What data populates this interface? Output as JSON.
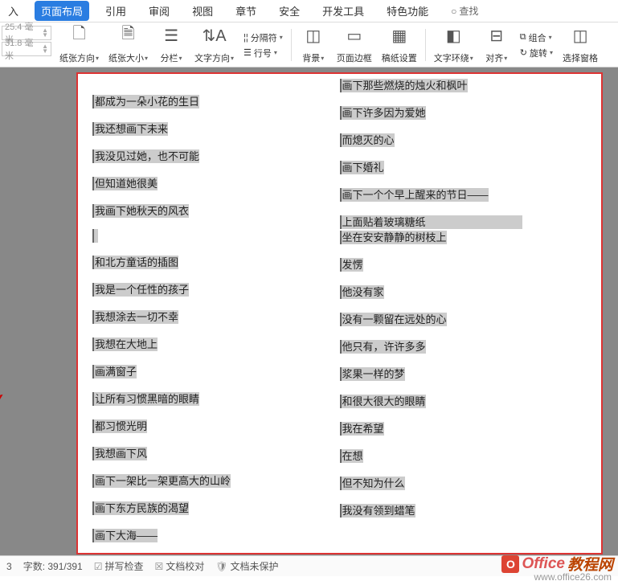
{
  "tabs": {
    "insert": "入",
    "pagelayout": "页面布局",
    "reference": "引用",
    "review": "审阅",
    "view": "视图",
    "chapter": "章节",
    "security": "安全",
    "devtools": "开发工具",
    "special": "特色功能",
    "search": "查找"
  },
  "margins": {
    "left": "25.4 毫米",
    "right": "31.8 毫米"
  },
  "toolbar": {
    "orientation": "纸张方向",
    "size": "纸张大小",
    "columns": "分栏",
    "textdir": "文字方向",
    "separator": "分隔符",
    "linenum": "行号",
    "background": "背景",
    "pageborder": "页面边框",
    "papersettings": "稿纸设置",
    "textwrap": "文字环绕",
    "align": "对齐",
    "group": "组合",
    "rotate": "旋转",
    "selpane": "选择窗格"
  },
  "content": {
    "left": [
      "都成为一朵小花的生日",
      "我还想画下未来",
      "我没见过她，也不可能",
      "但知道她很美",
      "我画下她秋天的风衣",
      "",
      "和北方童话的插图",
      "我是一个任性的孩子",
      "我想涂去一切不幸",
      "我想在大地上",
      "画满窗子",
      "让所有习惯黑暗的眼睛",
      "都习惯光明",
      "我想画下风",
      "画下一架比一架更高大的山岭",
      "画下东方民族的渴望",
      "画下大海——"
    ],
    "right": [
      "画下那些燃烧的烛火和枫叶",
      "画下许多因为爱她",
      "而熄灭的心",
      "画下婚礼",
      "画下一个个早上醒来的节日——",
      "上面贴着玻璃糖纸",
      "坐在安安静静的树枝上",
      "发愣",
      "他没有家",
      "没有一颗留在远处的心",
      "他只有，许许多多",
      "浆果一样的梦",
      "和很大很大的眼睛",
      "我在希望",
      "在想",
      "但不知为什么",
      "我没有领到蜡笔"
    ]
  },
  "status": {
    "page_indicator": "3",
    "wordcount": "字数: 391/391",
    "spellcheck": "拼写检查",
    "doccheck": "文档校对",
    "unprotected": "文档未保护"
  },
  "watermark": {
    "office": "Office",
    "wang": "教程网",
    "url": "www.office26.com"
  }
}
